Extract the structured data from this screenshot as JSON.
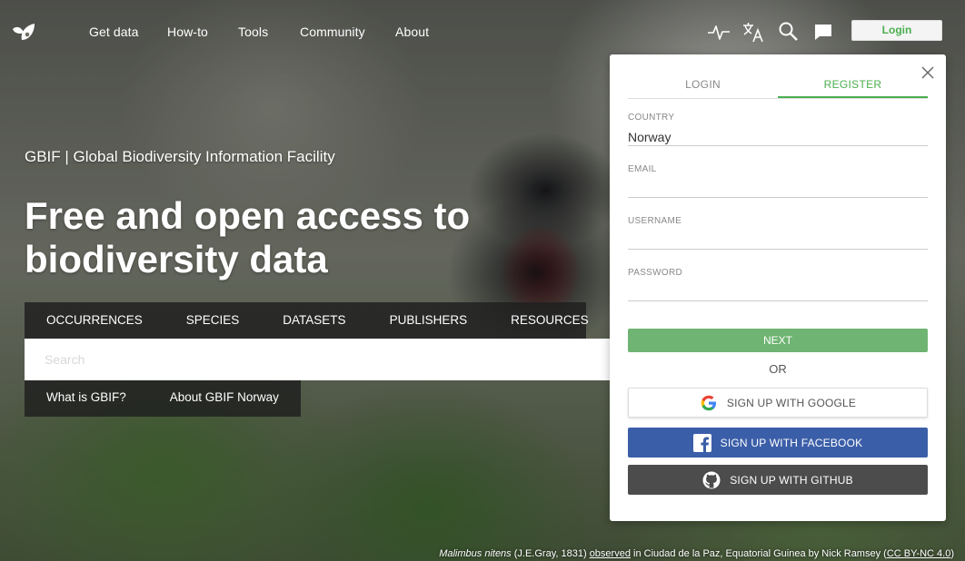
{
  "nav": {
    "links": [
      "Get data",
      "How-to",
      "Tools",
      "Community",
      "About"
    ],
    "login_label": "Login",
    "icons": [
      "activity-icon",
      "translate-icon",
      "search-icon",
      "feedback-icon"
    ]
  },
  "hero": {
    "site_name": "GBIF | Global Biodiversity Information Facility",
    "headline": "Free and open access to biodiversity data"
  },
  "search": {
    "tabs": [
      "OCCURRENCES",
      "SPECIES",
      "DATASETS",
      "PUBLISHERS",
      "RESOURCES"
    ],
    "placeholder": "Search",
    "info_links": [
      "What is GBIF?",
      "About GBIF Norway"
    ]
  },
  "modal": {
    "tabs": {
      "login": "LOGIN",
      "register": "REGISTER"
    },
    "active_tab": "register",
    "fields": {
      "country": {
        "label": "COUNTRY",
        "value": "Norway"
      },
      "email": {
        "label": "EMAIL",
        "value": ""
      },
      "username": {
        "label": "USERNAME",
        "value": ""
      },
      "password": {
        "label": "PASSWORD",
        "value": ""
      }
    },
    "next_label": "NEXT",
    "or_label": "OR",
    "google_label": "SIGN UP WITH GOOGLE",
    "facebook_label": "SIGN UP WITH FACEBOOK",
    "github_label": "SIGN UP WITH GITHUB"
  },
  "credit": {
    "species": "Malimbus nitens",
    "authority": " (J.E.Gray, 1831) ",
    "observed": "observed",
    "location": " in Ciudad de la Paz, Equatorial Guinea by Nick Ramsey (",
    "license": "CC BY-NC 4.0",
    "close_paren": ")"
  },
  "colors": {
    "accent_green": "#4caf50",
    "next_button": "#6fb472",
    "facebook": "#3b5ea8",
    "github": "#4c4c4c"
  }
}
